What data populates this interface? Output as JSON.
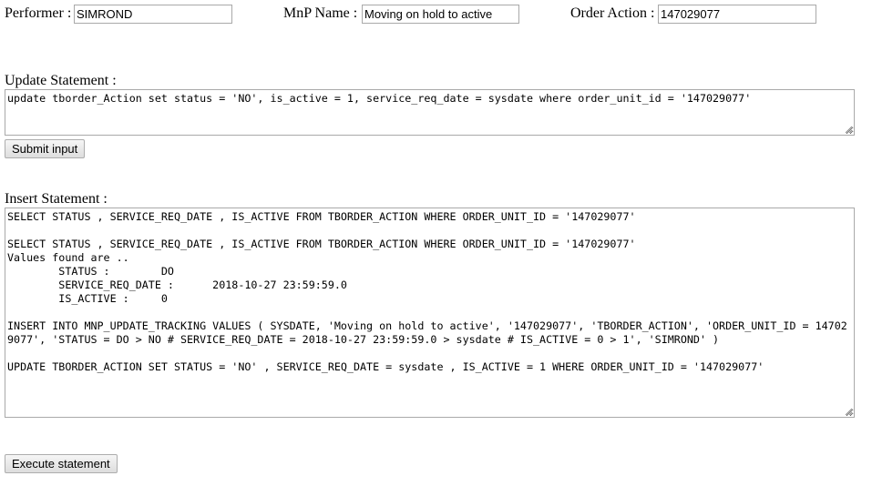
{
  "form": {
    "performer": {
      "label": "Performer :",
      "value": "SIMROND"
    },
    "mnp_name": {
      "label": "MnP Name :",
      "value": "Moving on hold to active"
    },
    "order_action": {
      "label": "Order Action :",
      "value": "147029077"
    }
  },
  "update": {
    "label": "Update Statement :",
    "value": "update tborder_Action set status = 'NO', is_active = 1, service_req_date = sysdate where order_unit_id = '147029077'",
    "submit_label": "Submit input"
  },
  "insert": {
    "label": "Insert Statement :",
    "value": "SELECT STATUS , SERVICE_REQ_DATE , IS_ACTIVE FROM TBORDER_ACTION WHERE ORDER_UNIT_ID = '147029077'\n\nSELECT STATUS , SERVICE_REQ_DATE , IS_ACTIVE FROM TBORDER_ACTION WHERE ORDER_UNIT_ID = '147029077'\nValues found are ..\n\tSTATUS :\tDO\n\tSERVICE_REQ_DATE :\t2018-10-27 23:59:59.0\n\tIS_ACTIVE :\t0\n\nINSERT INTO MNP_UPDATE_TRACKING VALUES ( SYSDATE, 'Moving on hold to active', '147029077', 'TBORDER_ACTION', 'ORDER_UNIT_ID = 147029077', 'STATUS = DO > NO # SERVICE_REQ_DATE = 2018-10-27 23:59:59.0 > sysdate # IS_ACTIVE = 0 > 1', 'SIMROND' )\n\nUPDATE TBORDER_ACTION SET STATUS = 'NO' , SERVICE_REQ_DATE = sysdate , IS_ACTIVE = 1 WHERE ORDER_UNIT_ID = '147029077'",
    "execute_label": "Execute statement"
  }
}
